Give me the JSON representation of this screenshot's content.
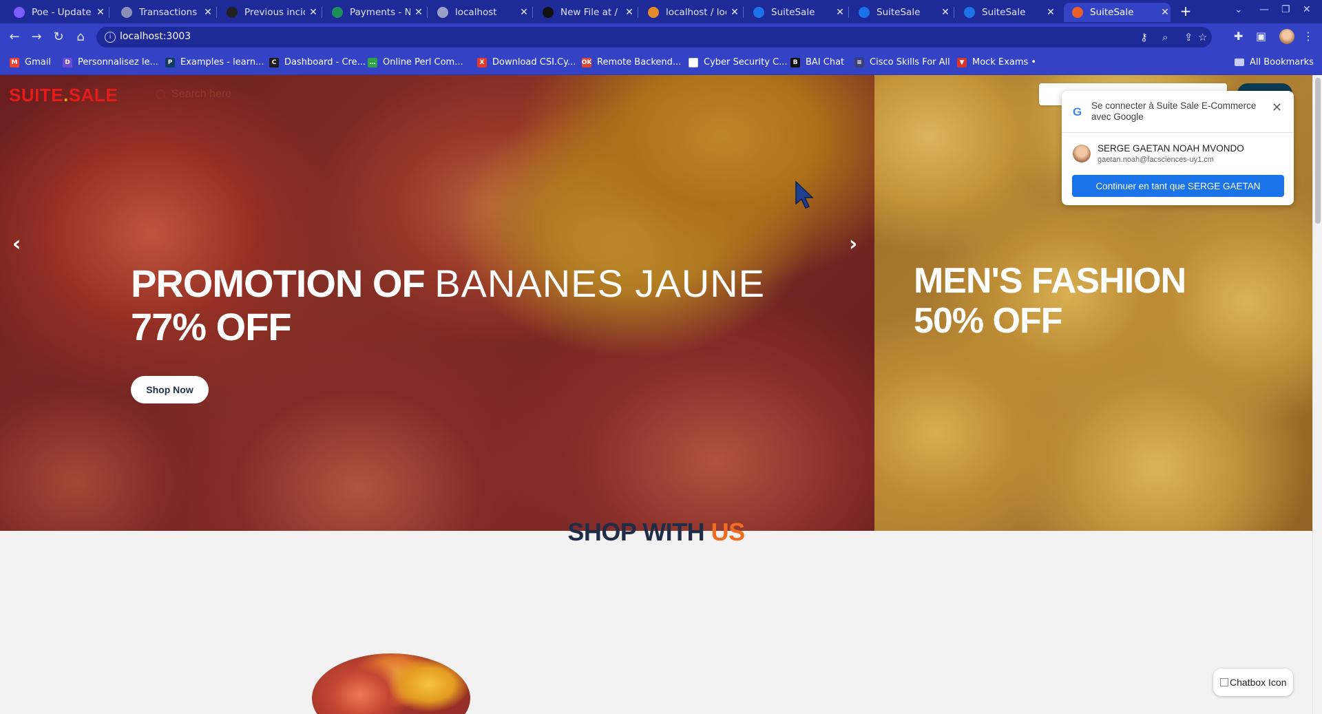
{
  "browser": {
    "tabs": [
      {
        "title": "Poe - Update C",
        "color": "#7b5cff"
      },
      {
        "title": "Transactions -",
        "color": "#8a8fb8"
      },
      {
        "title": "Previous incide",
        "color": "#222222"
      },
      {
        "title": "Payments - No",
        "color": "#1d8f5a"
      },
      {
        "title": "localhost",
        "color": "#9aa0c8"
      },
      {
        "title": "New File at / ·",
        "color": "#111111"
      },
      {
        "title": "localhost / loca",
        "color": "#e38a2b"
      },
      {
        "title": "SuiteSale",
        "color": "#1a73e8"
      },
      {
        "title": "SuiteSale",
        "color": "#1a73e8"
      },
      {
        "title": "SuiteSale",
        "color": "#1a73e8"
      },
      {
        "title": "SuiteSale",
        "color": "#e8612b",
        "active": true
      }
    ],
    "url": "localhost:3003",
    "bookmarks": [
      {
        "label": "Gmail",
        "color": "#ea4335",
        "glyph": "M"
      },
      {
        "label": "Personnalisez le...",
        "color": "#6c4bd8",
        "glyph": "D"
      },
      {
        "label": "Examples - learn...",
        "color": "#0e3a64",
        "glyph": "P"
      },
      {
        "label": "Dashboard - Cre...",
        "color": "#1d1d1d",
        "glyph": "C"
      },
      {
        "label": "Online Perl Com...",
        "color": "#2fa34a",
        "glyph": "…"
      },
      {
        "label": "Download CSI.Cy...",
        "color": "#e53a2a",
        "glyph": "X"
      },
      {
        "label": "Remote Backend...",
        "color": "#e2452f",
        "glyph": "OK"
      },
      {
        "label": "Cyber Security C...",
        "color": "#ffffff",
        "glyph": ""
      },
      {
        "label": "BAI Chat",
        "color": "#111111",
        "glyph": "B"
      },
      {
        "label": "Cisco Skills For All",
        "color": "#3a3f74",
        "glyph": "≡"
      },
      {
        "label": "Mock Exams •",
        "color": "#d9342b",
        "glyph": "▼"
      }
    ],
    "all_bookmarks": "All Bookmarks"
  },
  "header": {
    "brand_part1": "SUITE",
    "brand_dot": ".",
    "brand_part2": "SALE",
    "search_placeholder": "Search here"
  },
  "hero": {
    "slide1": {
      "line1_bold": "PROMOTION OF",
      "line1_light": "BANANES JAUNE",
      "line2": "77% OFF",
      "button": "Shop Now"
    },
    "slide2": {
      "line1": "MEN'S FASHION",
      "line2": "50% OFF"
    }
  },
  "section": {
    "title_main": "SHOP WITH",
    "title_accent": "US"
  },
  "chatbox_alt": "Chatbox Icon",
  "google_popup": {
    "title": "Se connecter à Suite Sale E-Commerce avec Google",
    "name": "SERGE GAETAN NOAH MVONDO",
    "email": "gaetan.noah@facsciences-uy1.cm",
    "button": "Continuer en tant que SERGE GAETAN"
  },
  "colors": {
    "brand_red": "#e81b1b",
    "accent_orange": "#f26b22",
    "navy": "#1f2d47",
    "google_blue": "#1a73e8"
  }
}
